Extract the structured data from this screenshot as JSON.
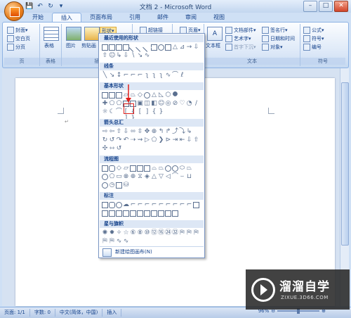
{
  "window": {
    "title": "文档 2 - Microsoft Word",
    "minimize": "–",
    "maximize": "□",
    "close": "✕"
  },
  "qat": {
    "save": "💾",
    "undo": "↶",
    "redo": "↻",
    "more": "▾"
  },
  "tabs": [
    "开始",
    "插入",
    "页面布局",
    "引用",
    "邮件",
    "审阅",
    "视图"
  ],
  "active_tab": "插入",
  "ribbon": {
    "pages_group": {
      "label": "页",
      "cover": "封面▾",
      "blank": "空白页",
      "break": "分页"
    },
    "table_group": {
      "label": "表格",
      "table": "表格"
    },
    "illus_group": {
      "label": "插",
      "picture": "图片",
      "clipart": "剪贴画",
      "shapes": "形状▾"
    },
    "links_group": {
      "hyperlink": "超链接"
    },
    "header_group": {
      "header": "页眉▾"
    },
    "text_group": {
      "label": "文本",
      "textbox": "文本框",
      "doc_parts": "文档部件▾",
      "wordart": "艺术字▾",
      "dropcap": "首字下沉▾",
      "signature": "签名行▾",
      "datetime": "日期和时间",
      "object": "对象▾"
    },
    "symbols_group": {
      "label": "符号",
      "formula": "公式▾",
      "symbol": "符号▾",
      "number": "编号"
    }
  },
  "shapes_menu": {
    "recent": "最近使用的形状",
    "lines": "线条",
    "basic": "基本形状",
    "arrows": "箭头总汇",
    "flowchart": "流程图",
    "callouts": "标注",
    "stars": "星与旗帜",
    "new_canvas": "新建绘图画布(N)"
  },
  "status": {
    "page": "页面: 1/1",
    "words": "字数: 0",
    "language": "中文(简体，中国)",
    "mode": "插入",
    "zoom": "96%"
  },
  "watermark": {
    "name": "溜溜自学",
    "url": "ZIXUE.3D66.COM"
  },
  "colors": {
    "accent": "#15428b",
    "highlight": "#e0201c",
    "ribbon": "#dbe7f7"
  }
}
